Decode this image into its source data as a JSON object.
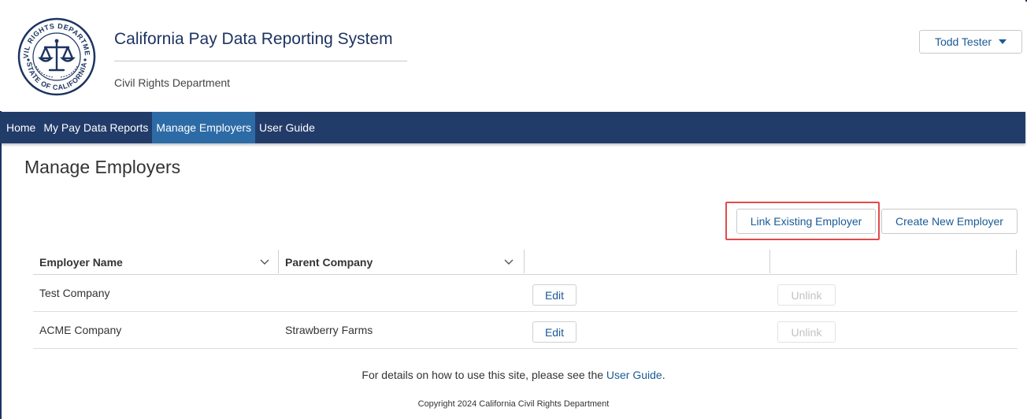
{
  "header": {
    "title": "California Pay Data Reporting System",
    "subtitle": "Civil Rights Department",
    "seal": {
      "top_text": "CIVIL RIGHTS DEPARTMENT",
      "bottom_text": "STATE OF CALIFORNIA"
    },
    "user_menu": {
      "label": "Todd Tester"
    }
  },
  "nav": {
    "items": [
      {
        "label": "Home",
        "active": false
      },
      {
        "label": "My Pay Data Reports",
        "active": false
      },
      {
        "label": "Manage Employers",
        "active": true
      },
      {
        "label": "User Guide",
        "active": false
      }
    ]
  },
  "page": {
    "title": "Manage Employers",
    "link_existing_label": "Link Existing Employer",
    "create_new_label": "Create New Employer"
  },
  "table": {
    "columns": [
      "Employer Name",
      "Parent Company"
    ],
    "rows": [
      {
        "employer_name": "Test Company",
        "parent_company": "",
        "edit_label": "Edit",
        "unlink_label": "Unlink"
      },
      {
        "employer_name": "ACME Company",
        "parent_company": "Strawberry Farms",
        "edit_label": "Edit",
        "unlink_label": "Unlink"
      }
    ]
  },
  "footer": {
    "text_before": "For details on how to use this site, please see the ",
    "link_label": "User Guide",
    "text_after": ".",
    "copyright": "Copyright 2024 California Civil Rights Department"
  },
  "colors": {
    "nav_bg": "#223c6a",
    "nav_active": "#2d6ba6",
    "link": "#1a5a96",
    "highlight": "#e34a4a"
  }
}
